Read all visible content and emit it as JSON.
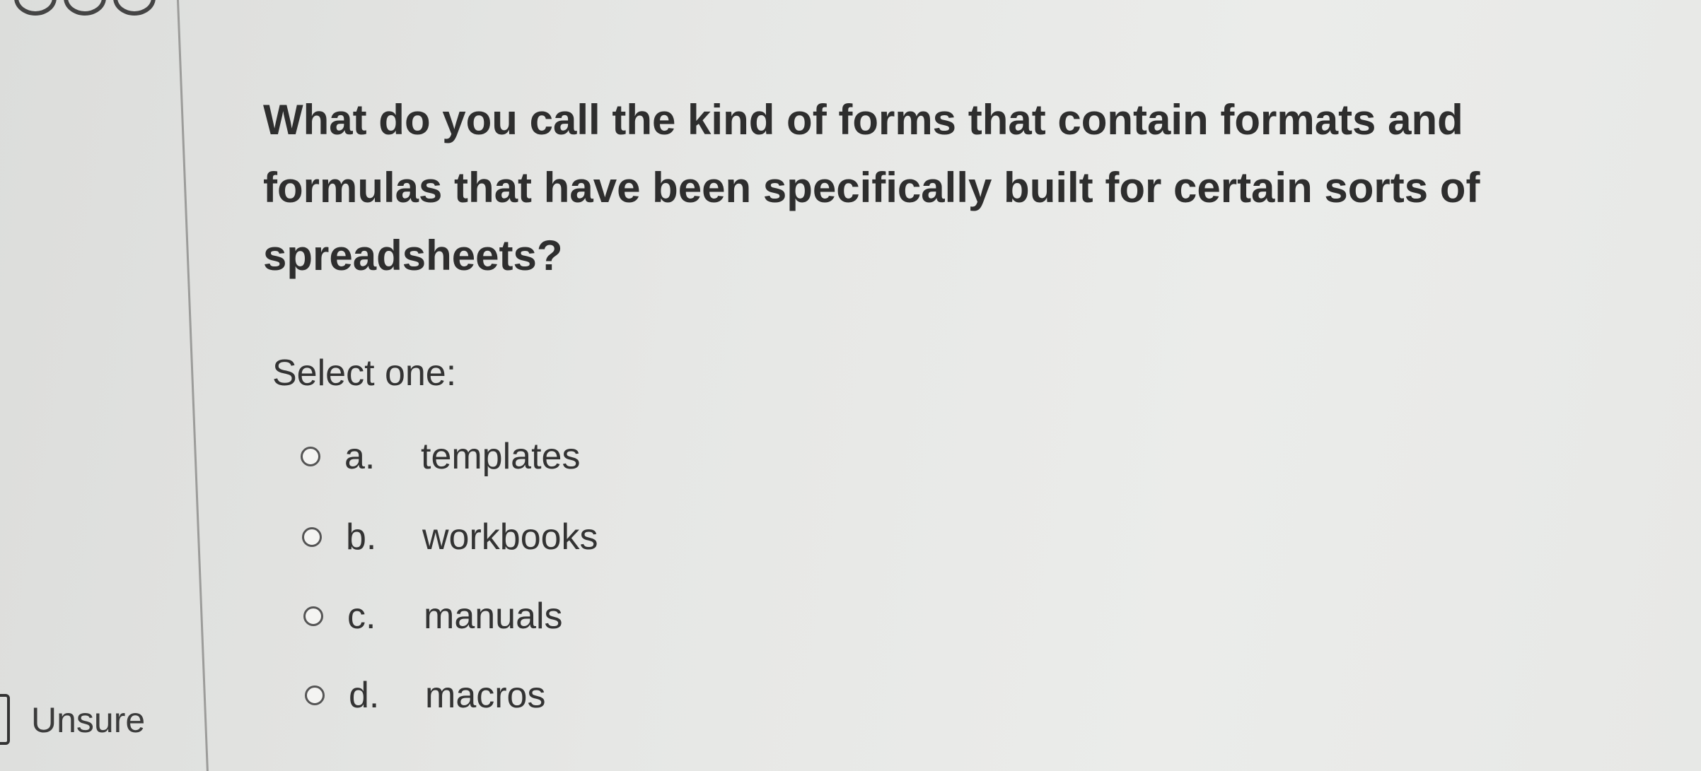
{
  "sidebar": {
    "flag_label": "Unsure"
  },
  "question": {
    "text": "What do you call the kind of forms that contain formats and formulas that have been specifically built for certain sorts of spreadsheets?",
    "prompt": "Select one:",
    "options": [
      {
        "letter": "a.",
        "text": "templates"
      },
      {
        "letter": "b.",
        "text": "workbooks"
      },
      {
        "letter": "c.",
        "text": "manuals"
      },
      {
        "letter": "d.",
        "text": "macros"
      }
    ]
  }
}
